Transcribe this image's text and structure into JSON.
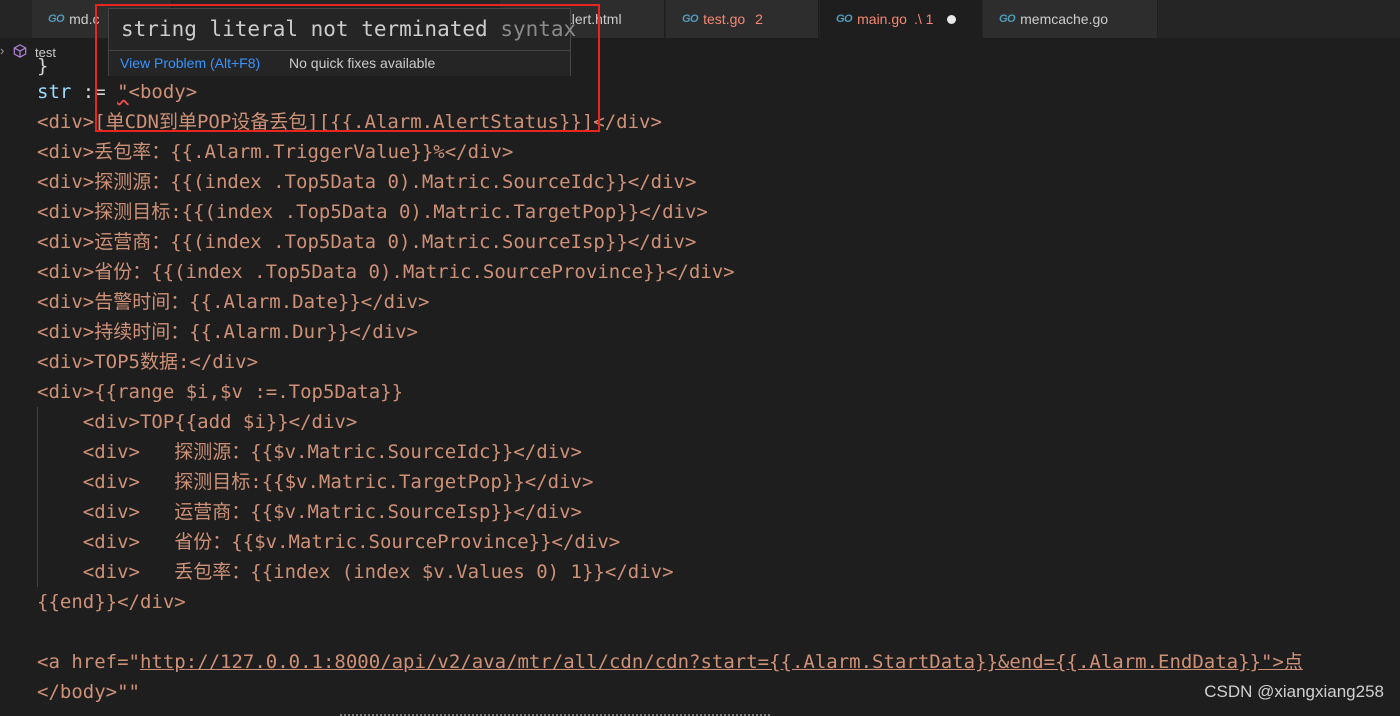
{
  "tabs": [
    {
      "label": "md.c",
      "badge": "",
      "modified": false
    },
    {
      "label": "alert.html",
      "badge": "",
      "modified": false
    },
    {
      "label": "test.go",
      "badge": "2",
      "modified": false
    },
    {
      "label": "main.go",
      "badge": ".\\ 1",
      "modified": true
    },
    {
      "label": "memcache.go",
      "badge": "",
      "modified": false
    }
  ],
  "icons": {
    "go": "GO",
    "breadcrumb": "package-cube-icon"
  },
  "breadcrumb": {
    "chevron": "›",
    "label": "test"
  },
  "hover": {
    "message": "string literal not terminated",
    "source": "syntax",
    "view_problem": "View Problem (Alt+F8)",
    "no_fixes": "No quick fixes available"
  },
  "code": {
    "l0": "}",
    "l1a": "str",
    "l1b": " := ",
    "l1c": "\"",
    "l1d": "<body>",
    "l2a": "<div>",
    "l2b": "[单CDN到单POP设备丢包]",
    "l2c": "[{{.Alarm.AlertStatus}}]</div>",
    "l3": "<div>丢包率：{{.Alarm.TriggerValue}}%</div>",
    "l4": "<div>探测源：{{(index .Top5Data 0).Matric.SourceIdc}}</div>",
    "l5": "<div>探测目标:{{(index .Top5Data 0).Matric.TargetPop}}</div>",
    "l6": "<div>运营商：{{(index .Top5Data 0).Matric.SourceIsp}}</div>",
    "l7": "<div>省份：{{(index .Top5Data 0).Matric.SourceProvince}}</div>",
    "l8": "<div>告警时间：{{.Alarm.Date}}</div>",
    "l9": "<div>持续时间：{{.Alarm.Dur}}</div>",
    "l10": "<div>TOP5数据:</div>",
    "l11": "<div>{{range $i,$v :=.Top5Data}}",
    "l12": "    <div>TOP{{add $i}}</div>",
    "l13": "    <div>   探测源：{{$v.Matric.SourceIdc}}</div>",
    "l14": "    <div>   探测目标:{{$v.Matric.TargetPop}}</div>",
    "l15": "    <div>   运营商：{{$v.Matric.SourceIsp}}</div>",
    "l16": "    <div>   省份：{{$v.Matric.SourceProvince}}</div>",
    "l17": "    <div>   丢包率：{{index (index $v.Values 0) 1}}</div>",
    "l18": "{{end}}</div>",
    "l20a": "<a href=\"",
    "l20b": "http",
    "l20c": "://127.0.0.1:8000/api/v2/ava/mtr/all/cdn/cdn?start={{.Alarm.StartData}}&end={{.Alarm.EndData}}\">点",
    "l21a": "</body>",
    "l21b": "\"\""
  },
  "watermark": "CSDN @xiangxiang258",
  "colors": {
    "error": "#f48771",
    "highlight_box": "#e8251f",
    "link": "#3794ff",
    "string": "#ce9178",
    "variable": "#9cdcfe"
  }
}
